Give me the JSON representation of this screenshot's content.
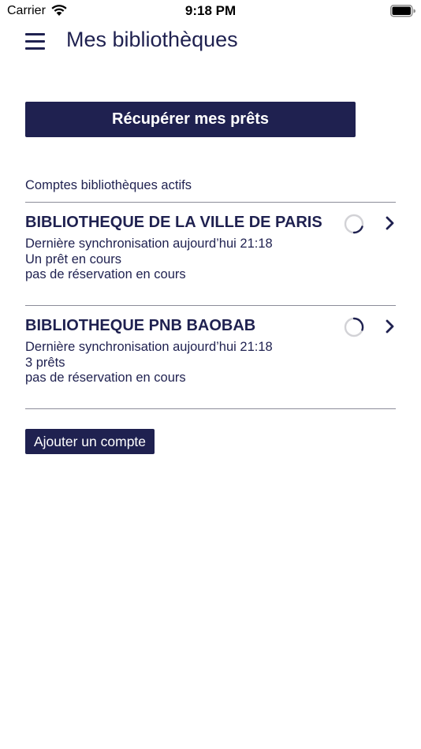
{
  "status_bar": {
    "carrier": "Carrier",
    "time": "9:18 PM"
  },
  "header": {
    "title": "Mes bibliothèques",
    "menu_icon": "hamburger-menu-icon"
  },
  "main": {
    "fetch_button_label": "Récupérer mes prêts",
    "section_title": "Comptes bibliothèques actifs",
    "accounts": [
      {
        "name": "BIBLIOTHEQUE DE LA VILLE DE PARIS",
        "sync": "Dernière synchronisation aujourd’hui 21:18",
        "loans": "Un prêt en cours",
        "reservations": "pas de réservation en cours"
      },
      {
        "name": "BIBLIOTHEQUE PNB BAOBAB",
        "sync": "Dernière synchronisation aujourd’hui 21:18",
        "loans": "3 prêts",
        "reservations": "pas de réservation en cours"
      }
    ],
    "add_account_label": "Ajouter un compte"
  },
  "colors": {
    "primary": "#1f2150",
    "divider": "#8b8c99",
    "background": "#ffffff"
  }
}
